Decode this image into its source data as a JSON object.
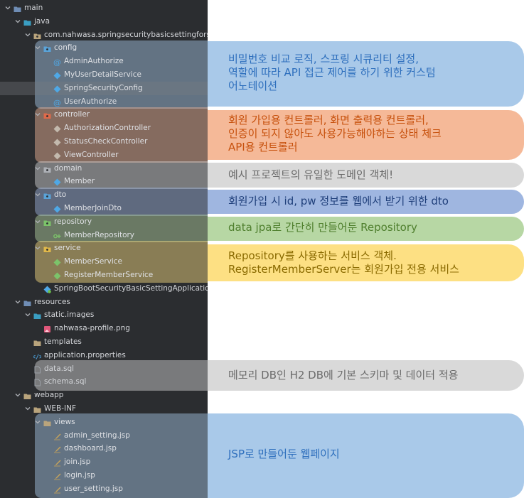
{
  "tree": {
    "rows": [
      {
        "label": "main",
        "icon": "folder-icon",
        "color": "#6f8db5"
      },
      {
        "label": "java",
        "icon": "folder-icon",
        "color": "#3a9ec2"
      },
      {
        "label": "com.nahwasa.springsecuritybasicsettingforsp",
        "icon": "package-icon",
        "color": "#b9a47c"
      },
      {
        "label": "config",
        "icon": "package-icon",
        "color": "#5aa3d8"
      },
      {
        "label": "AdminAuthorize",
        "icon": "annotation-icon",
        "color": "#4fa8e6"
      },
      {
        "label": "MyUserDetailService",
        "icon": "class-icon",
        "color": "#4fa8e6"
      },
      {
        "label": "SpringSecurityConfig",
        "icon": "class-icon",
        "color": "#4fa8e6"
      },
      {
        "label": "UserAuthorize",
        "icon": "annotation-icon",
        "color": "#4fa8e6"
      },
      {
        "label": "controller",
        "icon": "package-icon",
        "color": "#e06a4a"
      },
      {
        "label": "AuthorizationController",
        "icon": "class-icon",
        "color": "#c3b9ad"
      },
      {
        "label": "StatusCheckController",
        "icon": "class-icon",
        "color": "#c3b9ad"
      },
      {
        "label": "ViewController",
        "icon": "class-icon",
        "color": "#c3b9ad"
      },
      {
        "label": "domain",
        "icon": "package-icon",
        "color": "#aeb1b7"
      },
      {
        "label": "Member",
        "icon": "class-icon",
        "color": "#4fa8e6"
      },
      {
        "label": "dto",
        "icon": "package-icon",
        "color": "#5aa3d8"
      },
      {
        "label": "MemberJoinDto",
        "icon": "class-icon",
        "color": "#4fa8e6"
      },
      {
        "label": "repository",
        "icon": "package-icon",
        "color": "#7cc36a"
      },
      {
        "label": "MemberRepository",
        "icon": "interface-icon",
        "color": "#7cc36a"
      },
      {
        "label": "service",
        "icon": "package-icon",
        "color": "#e0b84a"
      },
      {
        "label": "MemberService",
        "icon": "class-icon",
        "color": "#7cc36a"
      },
      {
        "label": "RegisterMemberService",
        "icon": "class-icon",
        "color": "#7cc36a"
      },
      {
        "label": "SpringBootSecurityBasicSettingApplication",
        "icon": "spring-class-icon",
        "color": "#4fa8e6"
      },
      {
        "label": "resources",
        "icon": "folder-icon",
        "color": "#6f8db5"
      },
      {
        "label": "static.images",
        "icon": "folder-icon",
        "color": "#3a9ec2"
      },
      {
        "label": "nahwasa-profile.png",
        "icon": "image-file-icon",
        "color": "#e0577a"
      },
      {
        "label": "templates",
        "icon": "folder-icon",
        "color": "#b9a47c"
      },
      {
        "label": "application.properties",
        "icon": "properties-file-icon",
        "color": "#4fa8e6"
      },
      {
        "label": "data.sql",
        "icon": "sql-file-icon",
        "color": "#9aa0a6"
      },
      {
        "label": "schema.sql",
        "icon": "sql-file-icon",
        "color": "#9aa0a6"
      },
      {
        "label": "webapp",
        "icon": "folder-icon",
        "color": "#b9a47c"
      },
      {
        "label": "WEB-INF",
        "icon": "folder-icon",
        "color": "#b9a47c"
      },
      {
        "label": "views",
        "icon": "folder-icon",
        "color": "#b9a47c"
      },
      {
        "label": "admin_setting.jsp",
        "icon": "jsp-file-icon",
        "color": "#c8a45a"
      },
      {
        "label": "dashboard.jsp",
        "icon": "jsp-file-icon",
        "color": "#c8a45a"
      },
      {
        "label": "join.jsp",
        "icon": "jsp-file-icon",
        "color": "#c8a45a"
      },
      {
        "label": "login.jsp",
        "icon": "jsp-file-icon",
        "color": "#c8a45a"
      },
      {
        "label": "user_setting.jsp",
        "icon": "jsp-file-icon",
        "color": "#c8a45a"
      }
    ]
  },
  "annotations": [
    {
      "lines": [
        "비밀번호 비교 로직, 스프링 시큐리티 설정,",
        "역할에 따라 API 접근 제어를 하기 위한 커스텀",
        "어노테이션"
      ],
      "color": "#a9c9e9",
      "text_color": "#2e6fbd"
    },
    {
      "lines": [
        "회원 가입용 컨트롤러, 화면 출력용 컨트롤러,",
        "인증이 되지 않아도 사용가능해야하는 상태 체크",
        "API용 컨트롤러"
      ],
      "color": "#f5b998",
      "text_color": "#c7510d"
    },
    {
      "lines": [
        "예시 프로젝트의 유일한 도메인 객체!"
      ],
      "color": "#d9d9d9",
      "text_color": "#6b6b6b"
    },
    {
      "lines": [
        "회원가입 시 id, pw 정보를 웹에서 받기 위한 dto"
      ],
      "color": "#9fb6e0",
      "text_color": "#1f3f7a"
    },
    {
      "lines": [
        "data jpa로 간단히 만들어둔 Repository"
      ],
      "color": "#b7d7a4",
      "text_color": "#4f7f2e"
    },
    {
      "lines": [
        "Repository를 사용하는 서비스 객체.",
        "RegisterMemberServer는 회원가입 전용 서비스"
      ],
      "color": "#fde083",
      "text_color": "#8a6a00"
    },
    {
      "lines": [
        "메모리 DB인 H2 DB에 기본 스키마 및 데이터 적용"
      ],
      "color": "#d9d9d9",
      "text_color": "#6b6b6b"
    },
    {
      "lines": [
        "JSP로 만들어둔 웹페이지"
      ],
      "color": "#a9c9e9",
      "text_color": "#2e6fbd"
    }
  ]
}
